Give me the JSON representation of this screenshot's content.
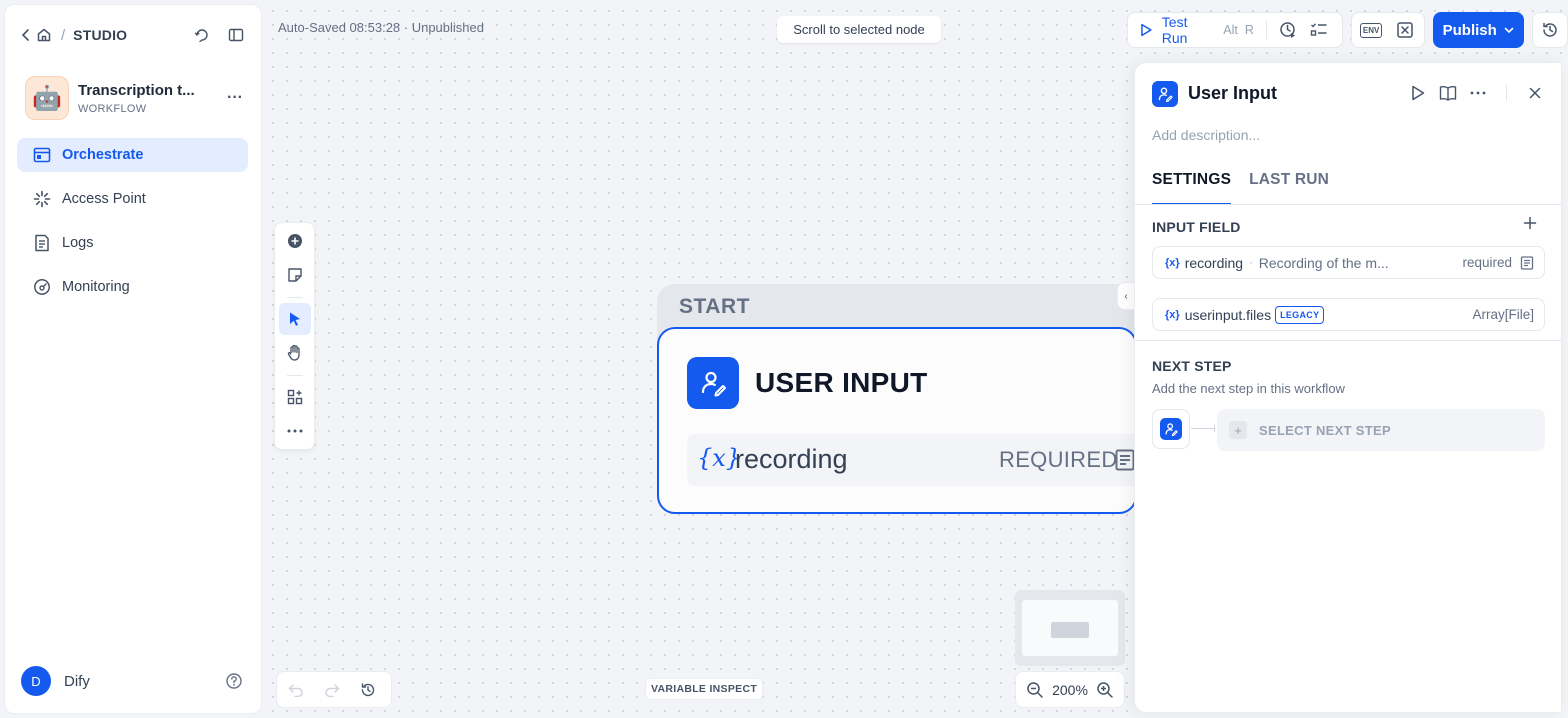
{
  "breadcrumb": {
    "studio": "STUDIO"
  },
  "app": {
    "name": "Transcription t...",
    "type": "WORKFLOW",
    "avatar": "🤖"
  },
  "sidebar": {
    "items": [
      {
        "label": "Orchestrate",
        "icon": "orchestrate-icon",
        "active": true
      },
      {
        "label": "Access Point",
        "icon": "access-point-icon",
        "active": false
      },
      {
        "label": "Logs",
        "icon": "logs-icon",
        "active": false
      },
      {
        "label": "Monitoring",
        "icon": "monitoring-icon",
        "active": false
      }
    ]
  },
  "user": {
    "initial": "D",
    "name": "Dify"
  },
  "canvas": {
    "autosave": "Auto-Saved 08:53:28 · Unpublished",
    "scroll_to_selected": "Scroll to selected node",
    "variable_inspect": "VARIABLE INSPECT",
    "zoom": "200%"
  },
  "toolbar": {
    "test_run": "Test Run",
    "shortcut_1": "Alt",
    "shortcut_2": "R",
    "env_label": "ENV",
    "publish": "Publish"
  },
  "node": {
    "group_label": "START",
    "title": "USER INPUT",
    "variable": {
      "name": "recording",
      "required": "REQUIRED"
    }
  },
  "panel": {
    "title": "User Input",
    "description_placeholder": "Add description...",
    "tabs": [
      {
        "label": "SETTINGS",
        "active": true
      },
      {
        "label": "LAST RUN",
        "active": false
      }
    ],
    "input_field_title": "INPUT FIELD",
    "fields": [
      {
        "name": "recording",
        "description": "Recording of the m...",
        "required": "required"
      },
      {
        "name": "userinput.files",
        "badge": "LEGACY",
        "type": "Array[File]"
      }
    ],
    "next_step_title": "NEXT STEP",
    "next_step_subtitle": "Add the next step in this workflow",
    "select_next_step": "SELECT NEXT STEP"
  },
  "colors": {
    "accent": "#155aef",
    "active_bg": "#e4ecff"
  }
}
